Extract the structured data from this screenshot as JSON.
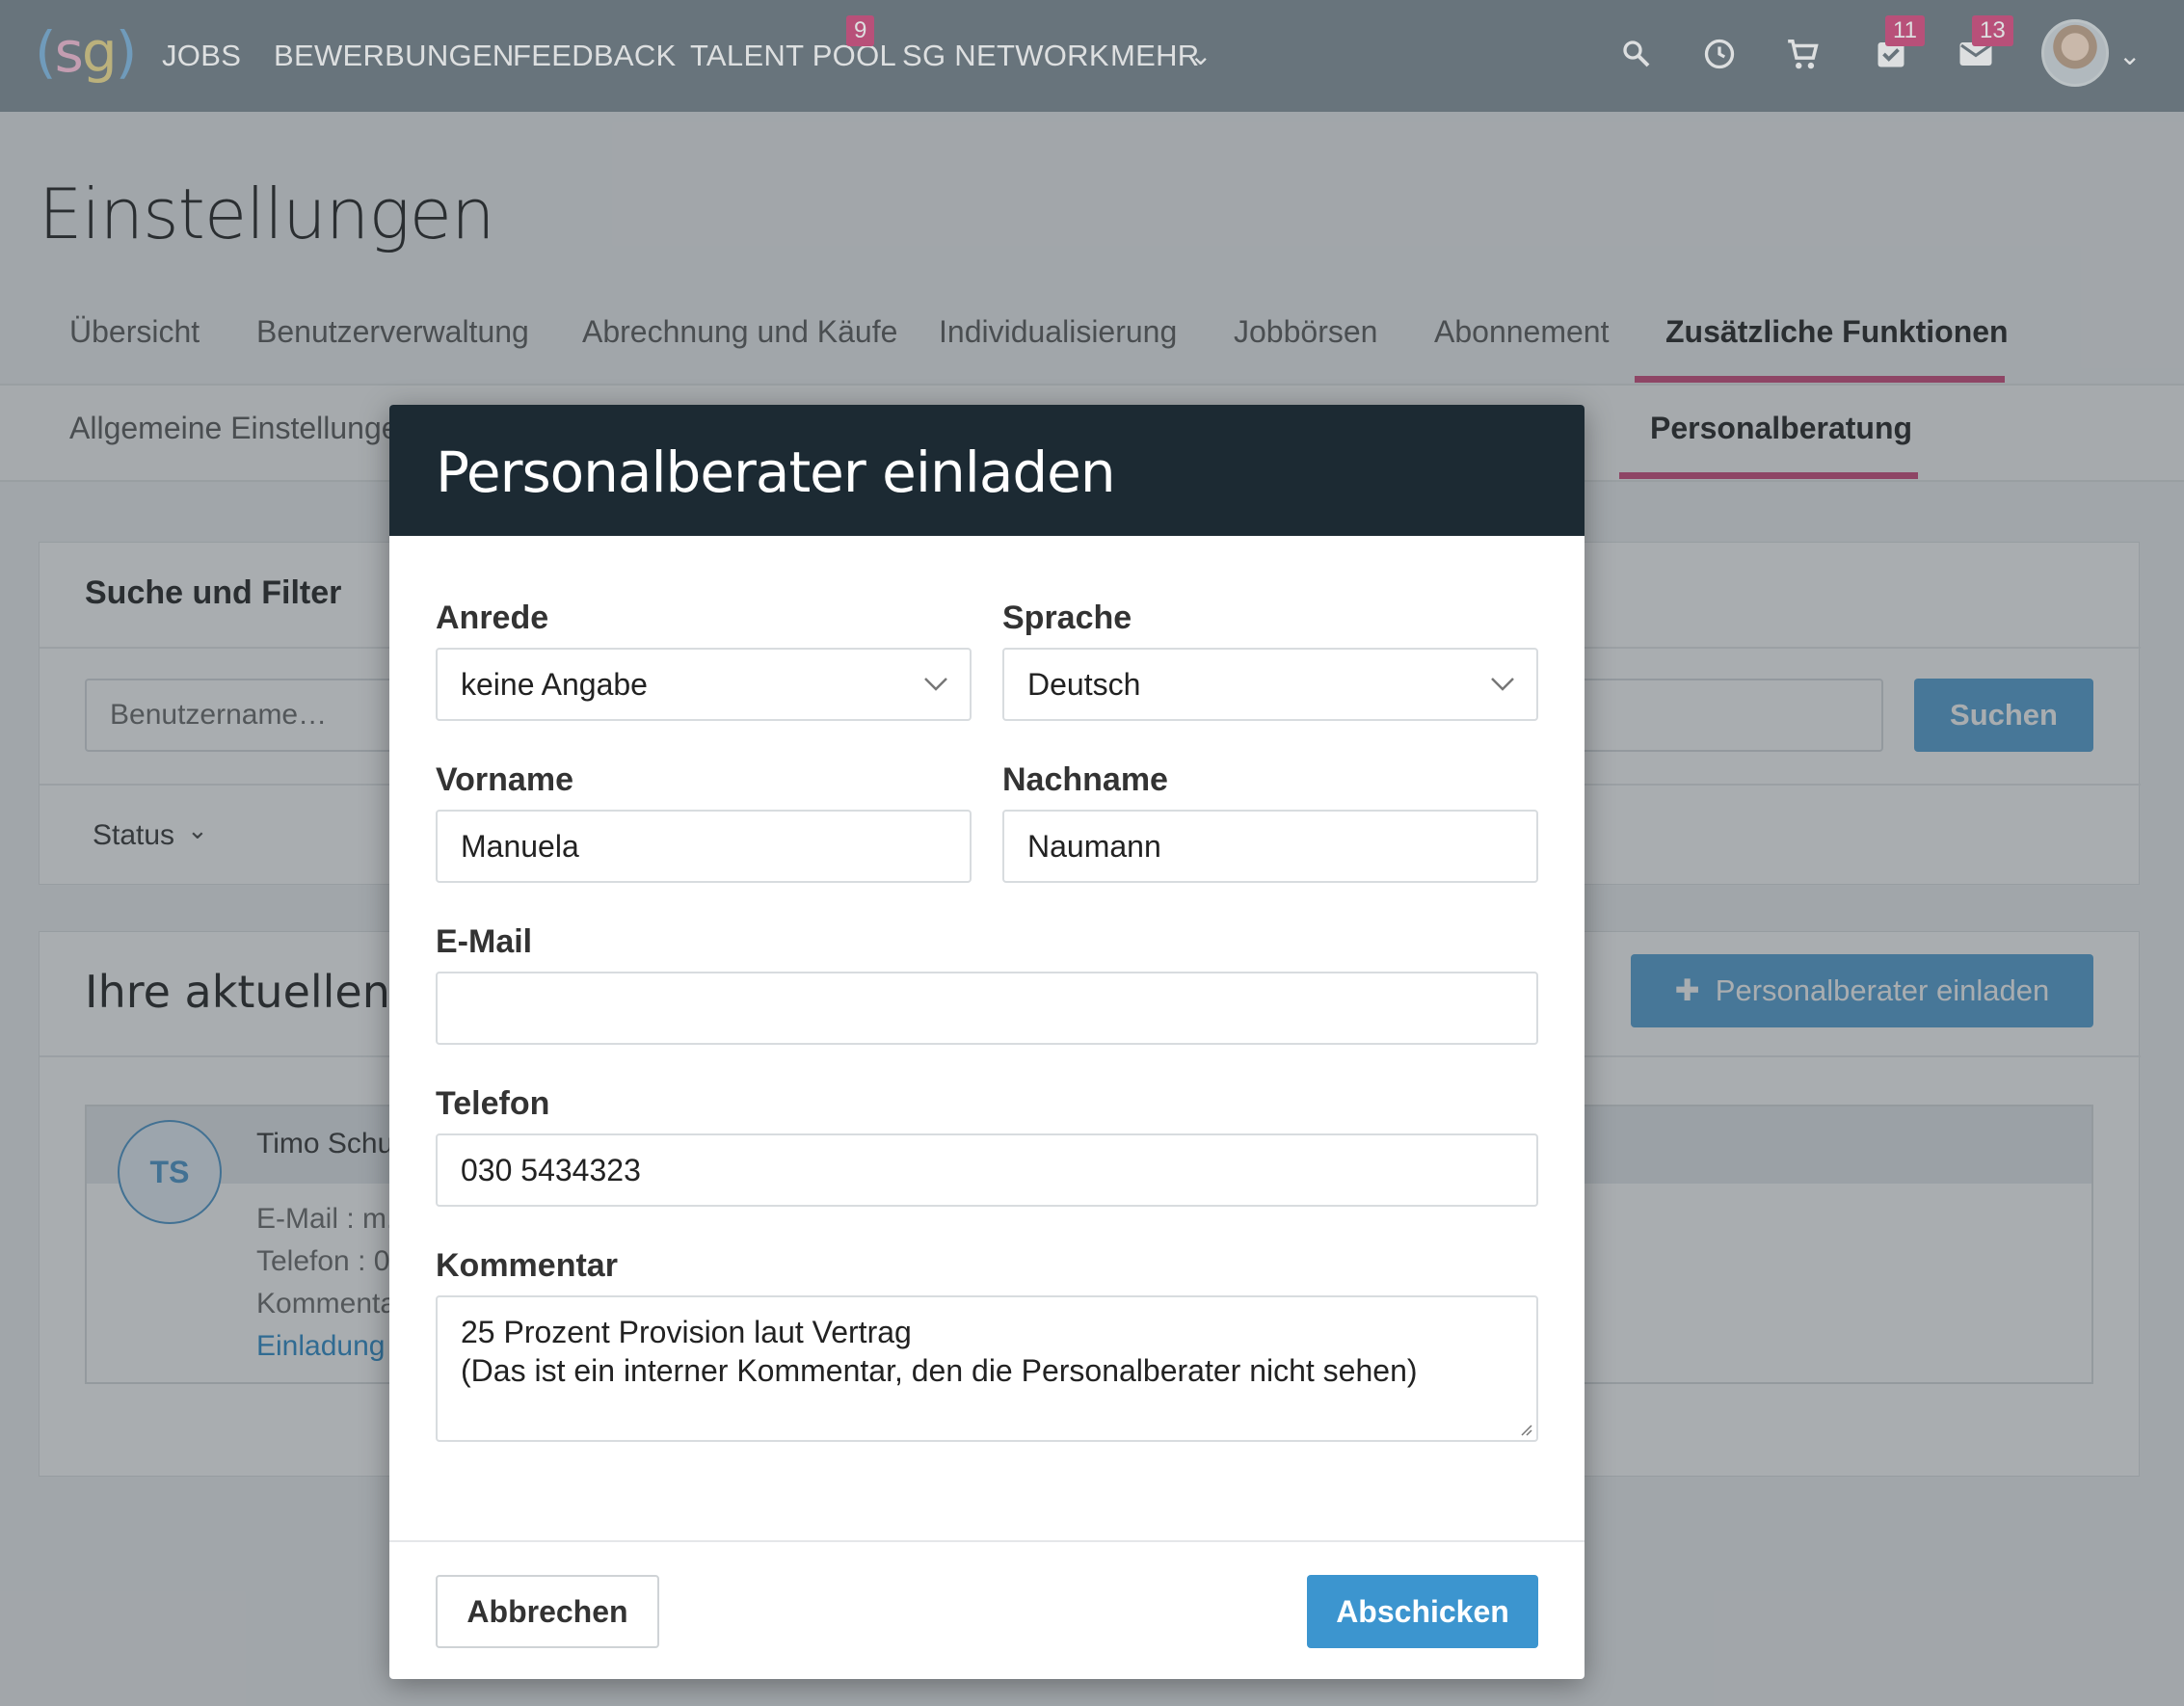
{
  "nav": {
    "logo": "(sg)",
    "items": [
      "JOBS",
      "BEWERBUNGEN",
      "FEEDBACK",
      "TALENT POOL",
      "SG NETWORK",
      "MEHR"
    ],
    "talent_pool_badge": "9",
    "tasks_badge": "11",
    "mail_badge": "13",
    "icons": [
      "search-icon",
      "clock-icon",
      "cart-icon",
      "tasks-icon",
      "mail-icon",
      "avatar",
      "chevron-down-icon"
    ]
  },
  "page": {
    "title": "Einstellungen",
    "tabs": [
      "Übersicht",
      "Benutzerverwaltung",
      "Abrechnung und Käufe",
      "Individualisierung",
      "Jobbörsen",
      "Abonnement",
      "Zusätzliche Funktionen"
    ],
    "subtabs": [
      "Allgemeine Einstellungen",
      "Personalberatung"
    ]
  },
  "filter": {
    "title": "Suche und Filter",
    "placeholder": "Benutzername…",
    "search_label": "Suchen",
    "status_label": "Status"
  },
  "list": {
    "title": "Ihre aktuellen Pe",
    "invite_label": "Personalberater einladen",
    "item": {
      "initials": "TS",
      "name": "Timo Schu",
      "email": "E-Mail : m.",
      "phone": "Telefon : 0",
      "comment": "Kommenta",
      "link": "Einladung"
    }
  },
  "modal": {
    "title": "Personalberater einladen",
    "salutation_label": "Anrede",
    "salutation_value": "keine Angabe",
    "language_label": "Sprache",
    "language_value": "Deutsch",
    "firstname_label": "Vorname",
    "firstname_value": "Manuela",
    "lastname_label": "Nachname",
    "lastname_value": "Naumann",
    "email_label": "E-Mail",
    "email_value": "",
    "phone_label": "Telefon",
    "phone_value": "030 5434323",
    "comment_label": "Kommentar",
    "comment_line1": "25 Prozent Provision laut Vertrag",
    "comment_line2": "(Das ist ein interner Kommentar, den die Personalberater nicht sehen)",
    "cancel_label": "Abbrechen",
    "submit_label": "Abschicken"
  },
  "colors": {
    "nav_bg": "#76828a",
    "accent": "#d45787",
    "primary": "#3c95cf",
    "modal_head": "#1c2a33"
  }
}
